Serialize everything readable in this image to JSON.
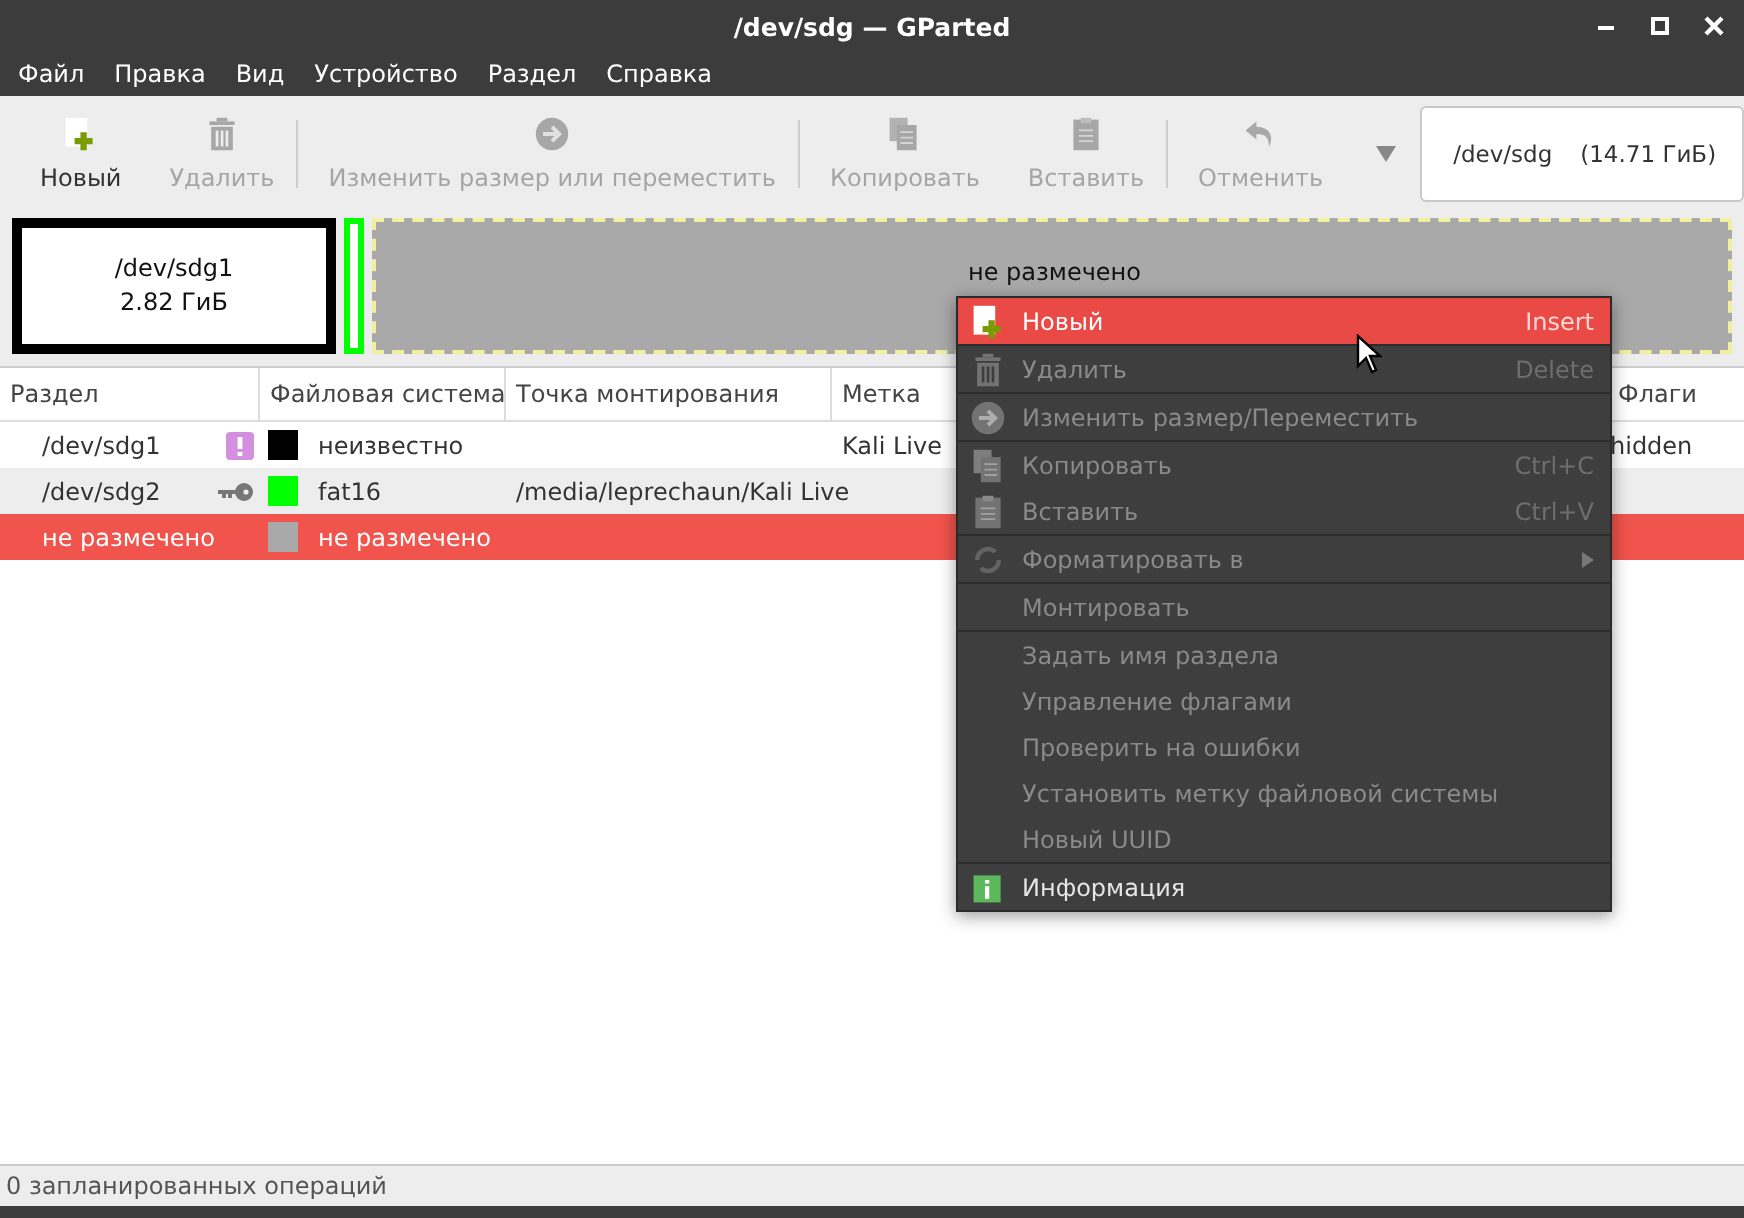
{
  "window": {
    "title": "/dev/sdg — GParted"
  },
  "menubar": [
    "Файл",
    "Правка",
    "Вид",
    "Устройство",
    "Раздел",
    "Справка"
  ],
  "toolbar": [
    {
      "label": "Новый",
      "kind": "new",
      "disabled": false,
      "separator_after": false
    },
    {
      "label": "Удалить",
      "kind": "delete",
      "disabled": true,
      "separator_after": true
    },
    {
      "label": "Изменить размер или переместить",
      "kind": "resize",
      "disabled": true,
      "separator_after": true
    },
    {
      "label": "Копировать",
      "kind": "copy",
      "disabled": true,
      "separator_after": false
    },
    {
      "label": "Вставить",
      "kind": "paste",
      "disabled": true,
      "separator_after": true
    },
    {
      "label": "Отменить",
      "kind": "undo",
      "disabled": true,
      "separator_after": false
    }
  ],
  "device": {
    "name": "/dev/sdg",
    "size": "(14.71 ГиБ)"
  },
  "disk_map": [
    {
      "kind": "partition",
      "name": "/dev/sdg1",
      "size": "2.82 ГиБ",
      "color": "#000000"
    },
    {
      "kind": "sliver",
      "color": "#00ff00"
    },
    {
      "kind": "unallocated",
      "name": "не размечено",
      "color": "#a9a9a9"
    }
  ],
  "table": {
    "columns": [
      "Раздел",
      "Файловая система",
      "Точка монтирования",
      "Метка",
      "Флаги"
    ],
    "rows": [
      {
        "partition": "/dev/sdg1",
        "kind": "warning",
        "color": "#000000",
        "filesystem": "неизвестно",
        "label": "Kali Live",
        "flags": "hidden",
        "selected": false
      },
      {
        "partition": "/dev/sdg2",
        "kind": "mounted",
        "color": "#00ff00",
        "filesystem": "fat16",
        "mountpoint": "/media/leprechaun/Kali Live",
        "selected": false
      },
      {
        "partition": "не размечено",
        "kind": "plain",
        "color": "#a9a9a9",
        "filesystem": "не размечено",
        "selected": true
      }
    ]
  },
  "context_menu": [
    {
      "label": "Новый",
      "shortcut": "Insert",
      "kind": "new",
      "disabled": false,
      "selected": true,
      "submenu": false,
      "separator_after": true
    },
    {
      "label": "Удалить",
      "shortcut": "Delete",
      "kind": "delete",
      "disabled": true,
      "selected": false,
      "submenu": false,
      "separator_after": true
    },
    {
      "label": "Изменить размер/Переместить",
      "kind": "resize",
      "disabled": true,
      "selected": false,
      "submenu": false,
      "separator_after": true
    },
    {
      "label": "Копировать",
      "shortcut": "Ctrl+C",
      "kind": "copy",
      "disabled": true,
      "selected": false,
      "submenu": false,
      "separator_after": false
    },
    {
      "label": "Вставить",
      "shortcut": "Ctrl+V",
      "kind": "paste",
      "disabled": true,
      "selected": false,
      "submenu": false,
      "separator_after": true
    },
    {
      "label": "Форматировать в",
      "kind": "format",
      "disabled": true,
      "selected": false,
      "submenu": true,
      "separator_after": true
    },
    {
      "label": "Монтировать",
      "kind": "plain",
      "disabled": true,
      "selected": false,
      "submenu": false,
      "separator_after": true
    },
    {
      "label": "Задать имя раздела",
      "kind": "plain",
      "disabled": true,
      "selected": false,
      "submenu": false,
      "separator_after": false
    },
    {
      "label": "Управление флагами",
      "kind": "plain",
      "disabled": true,
      "selected": false,
      "submenu": false,
      "separator_after": false
    },
    {
      "label": "Проверить на ошибки",
      "kind": "plain",
      "disabled": true,
      "selected": false,
      "submenu": false,
      "separator_after": false
    },
    {
      "label": "Установить метку файловой системы",
      "kind": "plain",
      "disabled": true,
      "selected": false,
      "submenu": false,
      "separator_after": false
    },
    {
      "label": "Новый UUID",
      "kind": "plain",
      "disabled": true,
      "selected": false,
      "submenu": false,
      "separator_after": true
    },
    {
      "label": "Информация",
      "kind": "info",
      "disabled": false,
      "selected": false,
      "submenu": false,
      "separator_after": false
    }
  ],
  "status_bar": "0 запланированных операций"
}
